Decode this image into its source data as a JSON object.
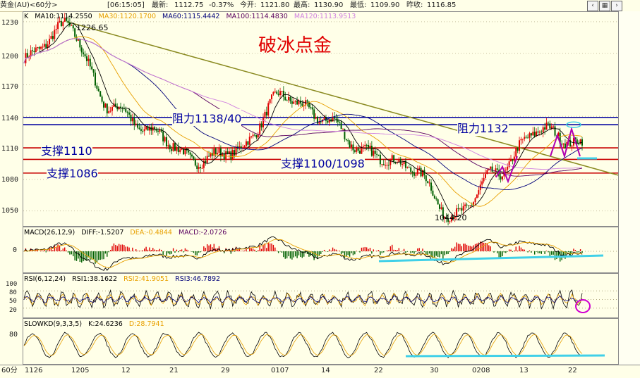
{
  "header": {
    "instrument": "黄金(AU)<60分>",
    "time": "[06:15:05]",
    "latest_label": "最新:",
    "latest": "1112.75",
    "change": "-0.37%",
    "open_label": "今开:",
    "open": "1121.80",
    "high_label": "最高:",
    "high": "1130.90",
    "low_label": "最低:",
    "low": "1109.90",
    "prev_label": "昨收:",
    "prev": "1116.85"
  },
  "colors": {
    "ma10": "#000000",
    "ma30": "#e8a000",
    "ma60": "#00007a",
    "ma100": "#5a0060",
    "ma120": "#d080e0",
    "up": "#e00000",
    "down": "#006000",
    "resist": "#0000a0",
    "support": "#c80000",
    "cyan": "#40d0e8",
    "trend": "#8a8a20"
  },
  "main": {
    "label": "K",
    "ma": [
      {
        "name": "MA10:",
        "value": "1114.2550",
        "color": "#000000"
      },
      {
        "name": "MA30:",
        "value": "1120.1700",
        "color": "#e8a000"
      },
      {
        "name": "MA60:",
        "value": "1115.4442",
        "color": "#00007a"
      },
      {
        "name": "MA100:",
        "value": "1114.4830",
        "color": "#5a0060"
      },
      {
        "name": "MA120:",
        "value": "1113.9513",
        "color": "#d080e0"
      }
    ],
    "title": "破冰点金",
    "y_ticks": [
      "1230",
      "1200",
      "1170",
      "1140",
      "1110",
      "1080",
      "1050"
    ],
    "labels": {
      "resist1": "阻力1138/40",
      "resist2": "阻力1132",
      "support1": "支撑1110",
      "support2": "支撑1086",
      "support3": "支撑1100/1098",
      "high": "1226.65",
      "low": "1044.20"
    }
  },
  "macd": {
    "label": "MACD(26,12,9)",
    "diff": "DIFF:-1.5207",
    "dea": "DEA:-0.4844",
    "macd": "MACD:-2.0726",
    "y0": "0"
  },
  "rsi": {
    "label": "RSI(6,12,24)",
    "r1": "RSI1:38.1622",
    "r2": "RSI2:41.9051",
    "r3": "RSI3:46.7892",
    "ticks": [
      "100",
      "80",
      "50",
      "20"
    ]
  },
  "slowkd": {
    "label": "SLOWKD(9,3,3,5)",
    "k": "K:24.6236",
    "d": "D:28.7941",
    "tick": "80"
  },
  "xaxis": {
    "period": "60分",
    "labels": [
      "1126",
      "1205",
      "12",
      "21",
      "29",
      "0107",
      "14",
      "22",
      "30",
      "0208",
      "13",
      "22"
    ]
  },
  "chart_data": {
    "type": "line",
    "title": "破冰点金",
    "ylim": [
      1035,
      1240
    ],
    "x": [
      "1126",
      "1205",
      "12",
      "21",
      "29",
      "0107",
      "14",
      "22",
      "30",
      "0208",
      "13",
      "22"
    ],
    "series": [
      {
        "values": [
          1195,
          1226.65,
          1150,
          1125,
          1098,
          1108,
          1160,
          1138,
          1105,
          1092,
          1044.2,
          1086,
          1128,
          1113
        ]
      }
    ],
    "annotations": [
      {
        "text": "阻力1138/40",
        "value": 1139
      },
      {
        "text": "阻力1132",
        "value": 1132
      },
      {
        "text": "支撑1110",
        "value": 1110
      },
      {
        "text": "支撑1100/1098",
        "value": 1099
      },
      {
        "text": "支撑1086",
        "value": 1086
      }
    ]
  }
}
